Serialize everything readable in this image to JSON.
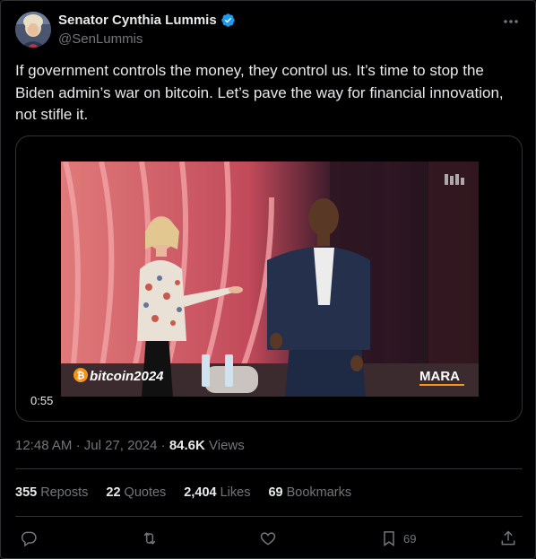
{
  "author": {
    "name": "Senator Cynthia Lummis",
    "handle": "@SenLummis"
  },
  "icons": {
    "verified": "verified-badge-icon",
    "more": "more-dots-icon",
    "reply": "reply-icon",
    "repost": "repost-icon",
    "like": "heart-icon",
    "bookmark": "bookmark-icon",
    "share": "share-icon"
  },
  "tweet": {
    "text": "If government controls the money, they control us. It’s time to stop the Biden admin’s war on bitcoin. Let’s pave the way for financial innovation, not stifle it."
  },
  "media": {
    "duration": "0:55",
    "overlay_left": "bitcoin2024",
    "overlay_right": "MARA"
  },
  "meta": {
    "time": "12:48 AM",
    "date": "Jul 27, 2024",
    "views_count": "84.6K",
    "views_label": "Views",
    "sep": "·"
  },
  "stats": {
    "reposts_count": "355",
    "reposts_label": "Reposts",
    "quotes_count": "22",
    "quotes_label": "Quotes",
    "likes_count": "2,404",
    "likes_label": "Likes",
    "bookmarks_count": "69",
    "bookmarks_label": "Bookmarks"
  },
  "actions": {
    "bookmark_count": "69"
  },
  "colors": {
    "background": "#000000",
    "text": "#e7e9ea",
    "muted": "#71767b",
    "border": "#2f3336",
    "verified": "#1d9bf0",
    "bitcoin_orange": "#f7931a"
  }
}
